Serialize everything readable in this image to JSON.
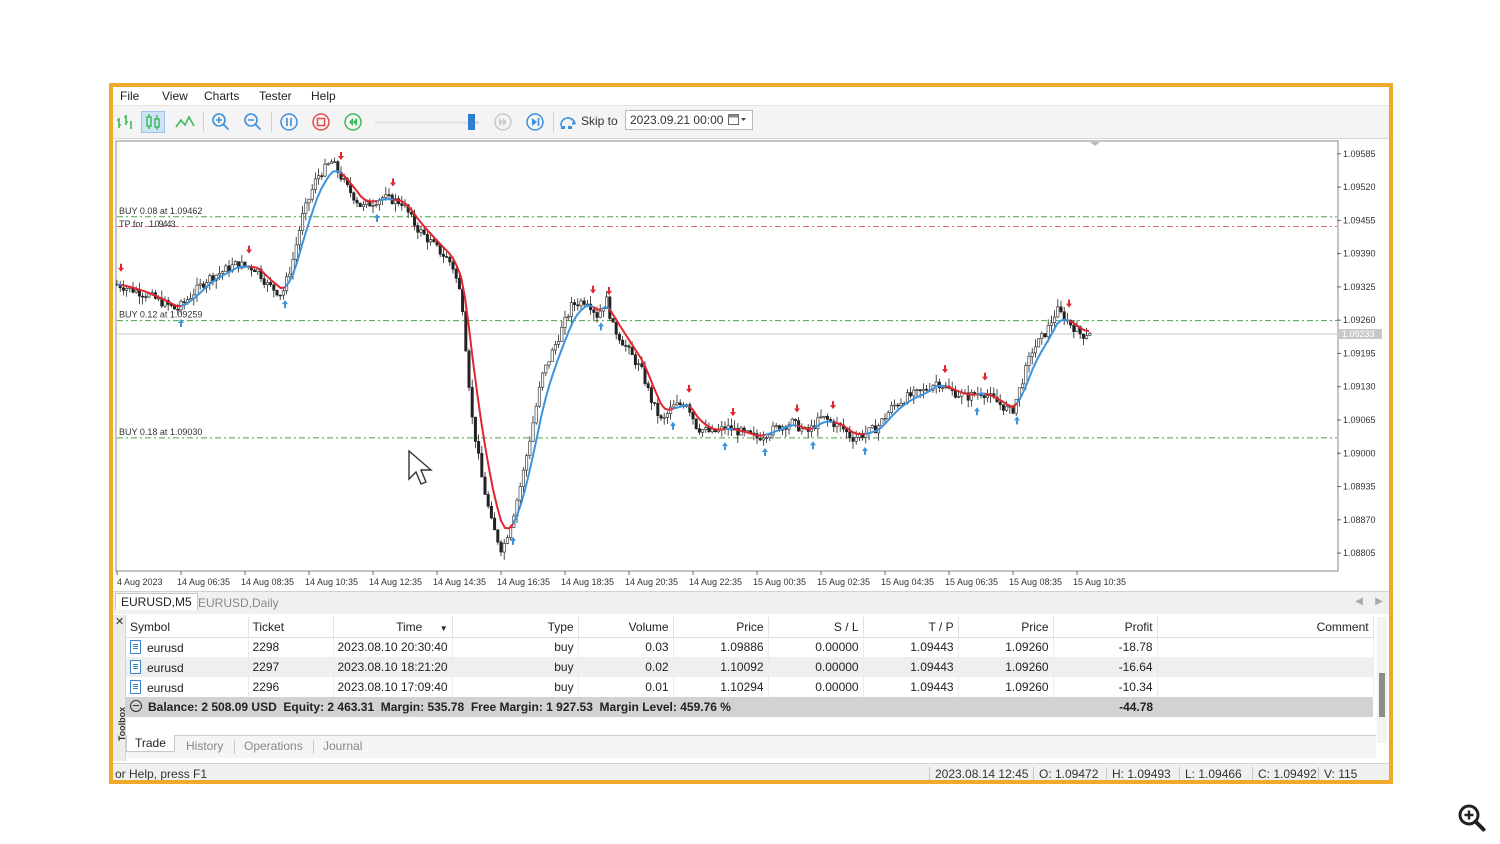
{
  "menu": [
    "File",
    "View",
    "Charts",
    "Tester",
    "Help"
  ],
  "toolbar": {
    "skip_label": "Skip to",
    "skip_value": "2023.09.21 00:00",
    "speed_level": 0.92,
    "icons": [
      "bar-chart-icon",
      "candlestick-icon",
      "line-chart-icon",
      "zoom-in-icon",
      "zoom-out-icon",
      "pause-icon",
      "stop-icon",
      "rewind-icon",
      "speed-slider",
      "step-icon",
      "skip-end-icon",
      "skip-to-icon",
      "calendar-icon"
    ],
    "colors": {
      "pause": "#3b8ee0",
      "stop": "#e24c4c",
      "rewind": "#3dbb5a"
    }
  },
  "chart_data": {
    "type": "candlestick",
    "symbol": "EURUSD,M5",
    "y_ticks": [
      "1.09585",
      "1.09520",
      "1.09455",
      "1.09390",
      "1.09325",
      "1.09260",
      "1.09195",
      "1.09130",
      "1.09065",
      "1.09000",
      "1.08935",
      "1.08870",
      "1.08805"
    ],
    "y_range": [
      1.0877,
      1.0961
    ],
    "current_price": "1.09233",
    "x_ticks": [
      "4 Aug 2023",
      "14 Aug 06:35",
      "14 Aug 08:35",
      "14 Aug 10:35",
      "14 Aug 12:35",
      "14 Aug 14:35",
      "14 Aug 16:35",
      "14 Aug 18:35",
      "14 Aug 20:35",
      "14 Aug 22:35",
      "15 Aug 00:35",
      "15 Aug 02:35",
      "15 Aug 04:35",
      "15 Aug 06:35",
      "15 Aug 08:35",
      "15 Aug 10:35"
    ],
    "price_path": [
      [
        0,
        1.0933
      ],
      [
        30,
        1.0931
      ],
      [
        60,
        1.0928
      ],
      [
        90,
        1.0934
      ],
      [
        120,
        1.0937
      ],
      [
        140,
        1.0936
      ],
      [
        150,
        1.0933
      ],
      [
        165,
        1.0931
      ],
      [
        175,
        1.0937
      ],
      [
        185,
        1.0946
      ],
      [
        200,
        1.0954
      ],
      [
        215,
        1.0957
      ],
      [
        230,
        1.0952
      ],
      [
        245,
        1.0948
      ],
      [
        265,
        1.095
      ],
      [
        285,
        1.0949
      ],
      [
        300,
        1.0944
      ],
      [
        320,
        1.094
      ],
      [
        335,
        1.0937
      ],
      [
        345,
        1.093
      ],
      [
        350,
        1.0918
      ],
      [
        355,
        1.0907
      ],
      [
        365,
        1.0895
      ],
      [
        375,
        1.0886
      ],
      [
        385,
        1.0881
      ],
      [
        395,
        1.0887
      ],
      [
        405,
        1.0895
      ],
      [
        415,
        1.0905
      ],
      [
        425,
        1.0915
      ],
      [
        440,
        1.0922
      ],
      [
        455,
        1.0929
      ],
      [
        470,
        1.093
      ],
      [
        480,
        1.0927
      ],
      [
        490,
        1.093
      ],
      [
        495,
        1.0925
      ],
      [
        505,
        1.0922
      ],
      [
        515,
        1.0919
      ],
      [
        525,
        1.0916
      ],
      [
        535,
        1.091
      ],
      [
        545,
        1.0906
      ],
      [
        555,
        1.0909
      ],
      [
        570,
        1.091
      ],
      [
        580,
        1.0905
      ],
      [
        595,
        1.0904
      ],
      [
        610,
        1.0905
      ],
      [
        625,
        1.0904
      ],
      [
        640,
        1.0903
      ],
      [
        660,
        1.0905
      ],
      [
        675,
        1.0906
      ],
      [
        690,
        1.0904
      ],
      [
        705,
        1.0907
      ],
      [
        725,
        1.0905
      ],
      [
        735,
        1.0903
      ],
      [
        750,
        1.0904
      ],
      [
        760,
        1.0905
      ],
      [
        775,
        1.0909
      ],
      [
        790,
        1.0911
      ],
      [
        805,
        1.0912
      ],
      [
        820,
        1.0914
      ],
      [
        835,
        1.0912
      ],
      [
        850,
        1.0911
      ],
      [
        865,
        1.0912
      ],
      [
        880,
        1.091
      ],
      [
        895,
        1.0908
      ],
      [
        905,
        1.0914
      ],
      [
        915,
        1.092
      ],
      [
        930,
        1.0924
      ],
      [
        940,
        1.0928
      ],
      [
        950,
        1.0926
      ],
      [
        965,
        1.0923
      ],
      [
        975,
        1.0924
      ]
    ],
    "ma_red": [
      [
        0,
        1.0931
      ],
      [
        60,
        1.0929
      ],
      [
        150,
        1.0932
      ],
      [
        175,
        1.0934
      ],
      [
        185,
        1.0942
      ],
      [
        205,
        1.0953
      ],
      [
        225,
        1.0955
      ],
      [
        240,
        1.0949
      ],
      [
        290,
        1.0949
      ],
      [
        310,
        1.0938
      ],
      [
        340,
        1.0936
      ],
      [
        348,
        1.0923
      ],
      [
        360,
        1.0905
      ],
      [
        372,
        1.0893
      ],
      [
        385,
        1.0884
      ],
      [
        398,
        1.0884
      ],
      [
        398,
        1.0884
      ]
    ],
    "ma_blue": [
      [
        0,
        1.0932
      ],
      [
        150,
        1.0932
      ],
      [
        172,
        1.0932
      ],
      [
        182,
        1.094
      ],
      [
        198,
        1.095
      ],
      [
        215,
        1.0954
      ],
      [
        232,
        1.0953
      ],
      [
        232,
        1.0953
      ]
    ],
    "lines": [
      {
        "label": "BUY 0.08 at 1.09462",
        "price": 1.09462,
        "color": "#4aa34a"
      },
      {
        "label": "BUY 0.12 at 1.09259",
        "price": 1.09259,
        "color": "#4aa34a"
      },
      {
        "label": "BUY 0.18 at 1.09030",
        "price": 1.0903,
        "color": "#4aa34a"
      },
      {
        "label": "",
        "price": 1.09443,
        "color": "#e26b6b"
      }
    ],
    "tp_label": "TP for",
    "tp_overlap": "1.09443",
    "colors": {
      "up": "#222222",
      "down": "#222222",
      "red_ma": "#e0262f",
      "blue_ma": "#3a94e0",
      "buy_arrow": "#3a94e0",
      "sell_arrow": "#e0262f"
    }
  },
  "chart_tabs": [
    "EURUSD,M5",
    "EURUSD,Daily"
  ],
  "trade_table": {
    "headers": [
      "Symbol",
      "Ticket",
      "Time",
      "Type",
      "Volume",
      "Price",
      "S / L",
      "T / P",
      "Price",
      "Profit",
      "Comment"
    ],
    "rows": [
      {
        "symbol": "eurusd",
        "ticket": "2298",
        "time": "2023.08.10 20:30:40",
        "type": "buy",
        "volume": "0.03",
        "price": "1.09886",
        "sl": "0.00000",
        "tp": "1.09443",
        "cur_price": "1.09260",
        "profit": "-18.78",
        "comment": ""
      },
      {
        "symbol": "eurusd",
        "ticket": "2297",
        "time": "2023.08.10 18:21:20",
        "type": "buy",
        "volume": "0.02",
        "price": "1.10092",
        "sl": "0.00000",
        "tp": "1.09443",
        "cur_price": "1.09260",
        "profit": "-16.64",
        "comment": ""
      },
      {
        "symbol": "eurusd",
        "ticket": "2296",
        "time": "2023.08.10 17:09:40",
        "type": "buy",
        "volume": "0.01",
        "price": "1.10294",
        "sl": "0.00000",
        "tp": "1.09443",
        "cur_price": "1.09260",
        "profit": "-10.34",
        "comment": ""
      }
    ],
    "balance_text": "Balance: 2 508.09 USD  Equity: 2 463.31  Margin: 535.78  Free Margin: 1 927.53  Margin Level: 459.76 %",
    "total_profit": "-44.78"
  },
  "toolbox_label": "Toolbox",
  "bottom_tabs": [
    "Trade",
    "History",
    "Operations",
    "Journal"
  ],
  "status": {
    "help": "or Help, press F1",
    "datetime": "2023.08.14 12:45",
    "open": "O: 1.09472",
    "high": "H: 1.09493",
    "low": "L: 1.09466",
    "close": "C: 1.09492",
    "volume": "V: 115"
  }
}
